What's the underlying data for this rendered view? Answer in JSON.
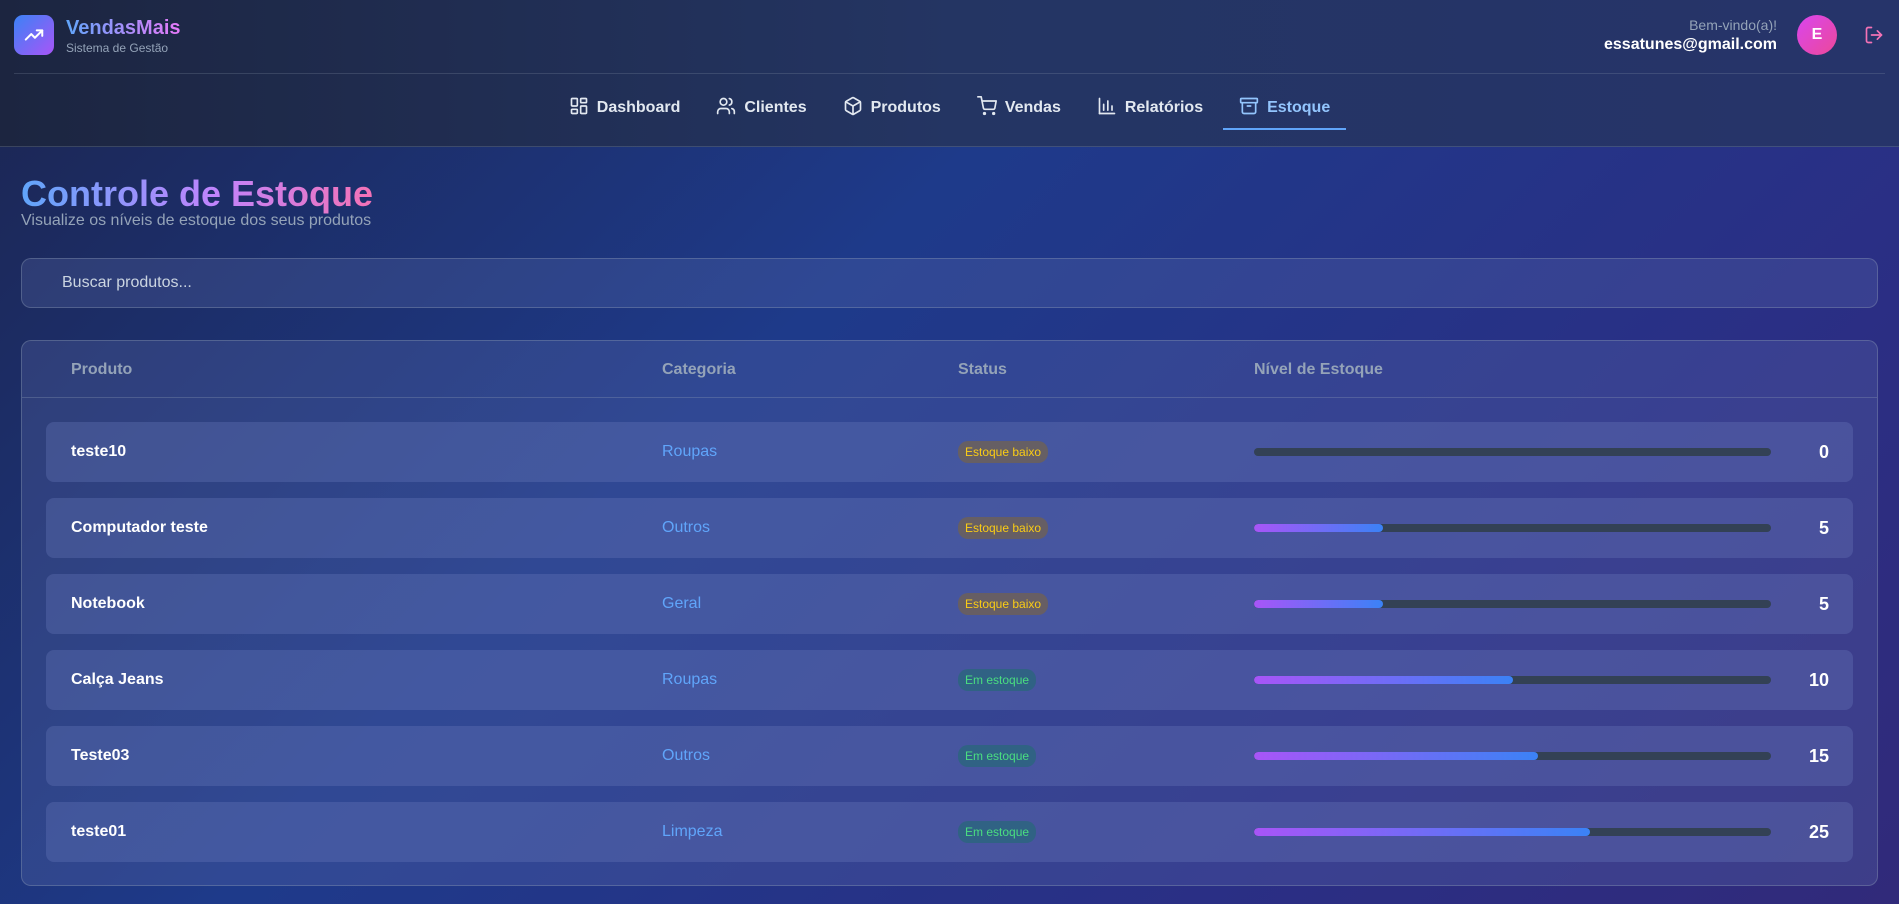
{
  "brand": {
    "title": "VendasMais",
    "subtitle": "Sistema de Gestão",
    "icon": "trending-up-icon"
  },
  "user": {
    "welcome": "Bem-vindo(a)!",
    "email": "essatunes@gmail.com",
    "avatar_initial": "E"
  },
  "nav": [
    {
      "label": "Dashboard",
      "icon": "dashboard-icon",
      "active": false
    },
    {
      "label": "Clientes",
      "icon": "users-icon",
      "active": false
    },
    {
      "label": "Produtos",
      "icon": "box-icon",
      "active": false
    },
    {
      "label": "Vendas",
      "icon": "cart-icon",
      "active": false
    },
    {
      "label": "Relatórios",
      "icon": "bar-chart-icon",
      "active": false
    },
    {
      "label": "Estoque",
      "icon": "archive-icon",
      "active": true
    }
  ],
  "page": {
    "title": "Controle de Estoque",
    "subtitle": "Visualize os níveis de estoque dos seus produtos"
  },
  "search": {
    "placeholder": "Buscar produtos...",
    "value": ""
  },
  "table": {
    "headers": {
      "produto": "Produto",
      "categoria": "Categoria",
      "status": "Status",
      "nivel": "Nível de Estoque"
    },
    "rows": [
      {
        "produto": "teste10",
        "categoria": "Roupas",
        "status": "Estoque baixo",
        "status_type": "low",
        "quantidade": "0",
        "nivel_fraction": 0
      },
      {
        "produto": "Computador teste",
        "categoria": "Outros",
        "status": "Estoque baixo",
        "status_type": "low",
        "quantidade": "5",
        "nivel_fraction": 0.25
      },
      {
        "produto": "Notebook",
        "categoria": "Geral",
        "status": "Estoque baixo",
        "status_type": "low",
        "quantidade": "5",
        "nivel_fraction": 0.25
      },
      {
        "produto": "Calça Jeans",
        "categoria": "Roupas",
        "status": "Em estoque",
        "status_type": "ok",
        "quantidade": "10",
        "nivel_fraction": 0.5
      },
      {
        "produto": "Teste03",
        "categoria": "Outros",
        "status": "Em estoque",
        "status_type": "ok",
        "quantidade": "15",
        "nivel_fraction": 0.55
      },
      {
        "produto": "teste01",
        "categoria": "Limpeza",
        "status": "Em estoque",
        "status_type": "ok",
        "quantidade": "25",
        "nivel_fraction": 0.65
      }
    ]
  },
  "colors": {
    "accent": "#60a5fa",
    "low_stock": "#facc15",
    "in_stock": "#4ade80"
  }
}
